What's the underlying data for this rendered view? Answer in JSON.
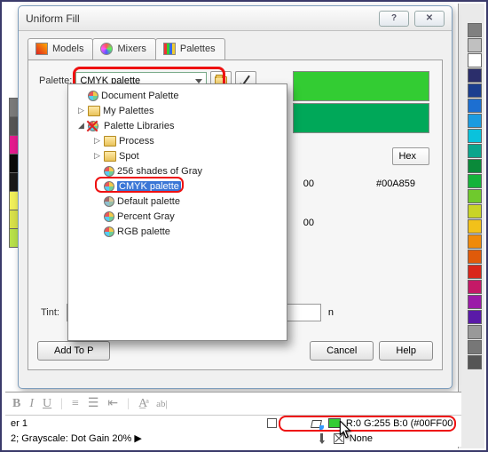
{
  "window": {
    "title": "Uniform Fill"
  },
  "tabs": {
    "models": "Models",
    "mixers": "Mixers",
    "palettes": "Palettes"
  },
  "palette": {
    "label": "Palette:",
    "selected": "CMYK palette",
    "tree": {
      "doc": "Document Palette",
      "my": "My Palettes",
      "lib": "Palette Libraries",
      "process": "Process",
      "spot": "Spot",
      "gray256": "256 shades of Gray",
      "cmyk": "CMYK palette",
      "default": "Default palette",
      "percent": "Percent Gray",
      "rgb": "RGB palette"
    }
  },
  "swatches": {
    "new": "#33cc33",
    "old": "#00A859"
  },
  "hex": {
    "label": "Hex",
    "value1": "00",
    "value2": "#00A859",
    "value3": "00"
  },
  "tint": {
    "label": "Tint:",
    "suffix": "n"
  },
  "buttons": {
    "add": "Add To P",
    "cancel": "Cancel",
    "help": "Help"
  },
  "status": {
    "layer": "er 1",
    "profile": "2; Grayscale: Dot Gain 20%  ▶",
    "fill": "R:0 G:255 B:0 (#00FF00)",
    "outline": "None"
  },
  "right_colors": [
    "#808080",
    "#c0c0c0",
    "#ffffff",
    "#2b2e6b",
    "#1b3e8f",
    "#1d6fd1",
    "#1b9be0",
    "#0ac2dc",
    "#0aa58c",
    "#0a8a3a",
    "#15b33a",
    "#6fc92d",
    "#c9d427",
    "#f2c11a",
    "#f08a0a",
    "#e05a0a",
    "#d9261a",
    "#c41967",
    "#9b1aa8",
    "#5a1aa8",
    "#999999",
    "#777777",
    "#555555"
  ],
  "left_colors": [
    "#7a7a7a",
    "#555555",
    "#e31b8e",
    "#0a0a0a",
    "#1a1a1a",
    "#f0ef5a",
    "#d7e04a",
    "#b7e04a"
  ]
}
